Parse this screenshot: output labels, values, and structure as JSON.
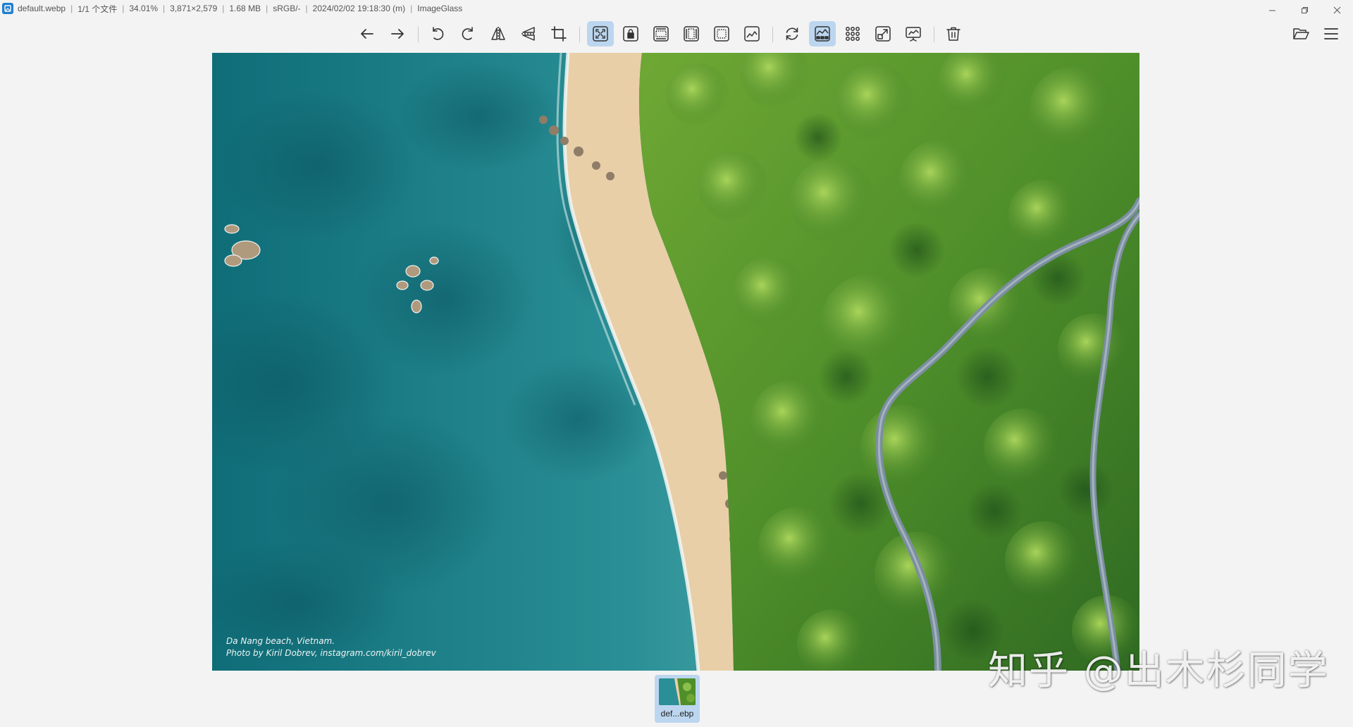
{
  "title_bar": {
    "filename": "default.webp",
    "file_index": "1/1 个文件",
    "zoom": "34.01%",
    "dimensions": "3,871×2,579",
    "file_size": "1.68 MB",
    "color_profile": "sRGB/-",
    "modified": "2024/02/02 19:18:30 (m)",
    "app_name": "ImageGlass",
    "separator": "|"
  },
  "window_controls": [
    "minimize-icon",
    "restore-icon",
    "close-icon"
  ],
  "toolbar": {
    "buttons": [
      {
        "name": "previous-image",
        "icon": "arrow-left-icon",
        "active": false
      },
      {
        "name": "next-image",
        "icon": "arrow-right-icon",
        "active": false
      },
      {
        "name": "rotate-left",
        "icon": "rotate-left-icon",
        "active": false
      },
      {
        "name": "rotate-right",
        "icon": "rotate-right-icon",
        "active": false
      },
      {
        "name": "flip-horizontal",
        "icon": "flip-horizontal-icon",
        "active": false
      },
      {
        "name": "flip-vertical",
        "icon": "flip-vertical-icon",
        "active": false
      },
      {
        "name": "crop",
        "icon": "crop-icon",
        "active": false
      },
      {
        "name": "auto-zoom",
        "icon": "auto-zoom-icon",
        "active": true
      },
      {
        "name": "lock-zoom",
        "icon": "lock-zoom-icon",
        "active": false
      },
      {
        "name": "scale-to-width",
        "icon": "scale-width-icon",
        "active": false
      },
      {
        "name": "scale-to-height",
        "icon": "scale-height-icon",
        "active": false
      },
      {
        "name": "scale-to-fit",
        "icon": "scale-fit-icon",
        "active": false
      },
      {
        "name": "scale-to-fill",
        "icon": "scale-fill-icon",
        "active": false
      },
      {
        "name": "refresh",
        "icon": "refresh-icon",
        "active": false
      },
      {
        "name": "toggle-gallery",
        "icon": "gallery-icon",
        "active": true
      },
      {
        "name": "toggle-checkerboard",
        "icon": "grid-dots-icon",
        "active": false
      },
      {
        "name": "fullscreen",
        "icon": "fullscreen-icon",
        "active": false
      },
      {
        "name": "slideshow",
        "icon": "slideshow-icon",
        "active": false
      },
      {
        "name": "delete",
        "icon": "trash-icon",
        "active": false
      }
    ],
    "right_buttons": [
      {
        "name": "open-file",
        "icon": "folder-open-icon"
      },
      {
        "name": "main-menu",
        "icon": "hamburger-menu-icon"
      }
    ]
  },
  "photo": {
    "caption_line1": "Da Nang beach, Vietnam.",
    "caption_line2": "Photo by Kiril Dobrev, instagram.com/kiril_dobrev"
  },
  "gallery": {
    "thumbnails": [
      {
        "label": "def...ebp",
        "selected": true
      }
    ]
  },
  "watermark": "知乎 @出木杉同学",
  "colors": {
    "accent": "#bcd6ef",
    "background": "#f3f3f3",
    "icon": "#333333"
  }
}
